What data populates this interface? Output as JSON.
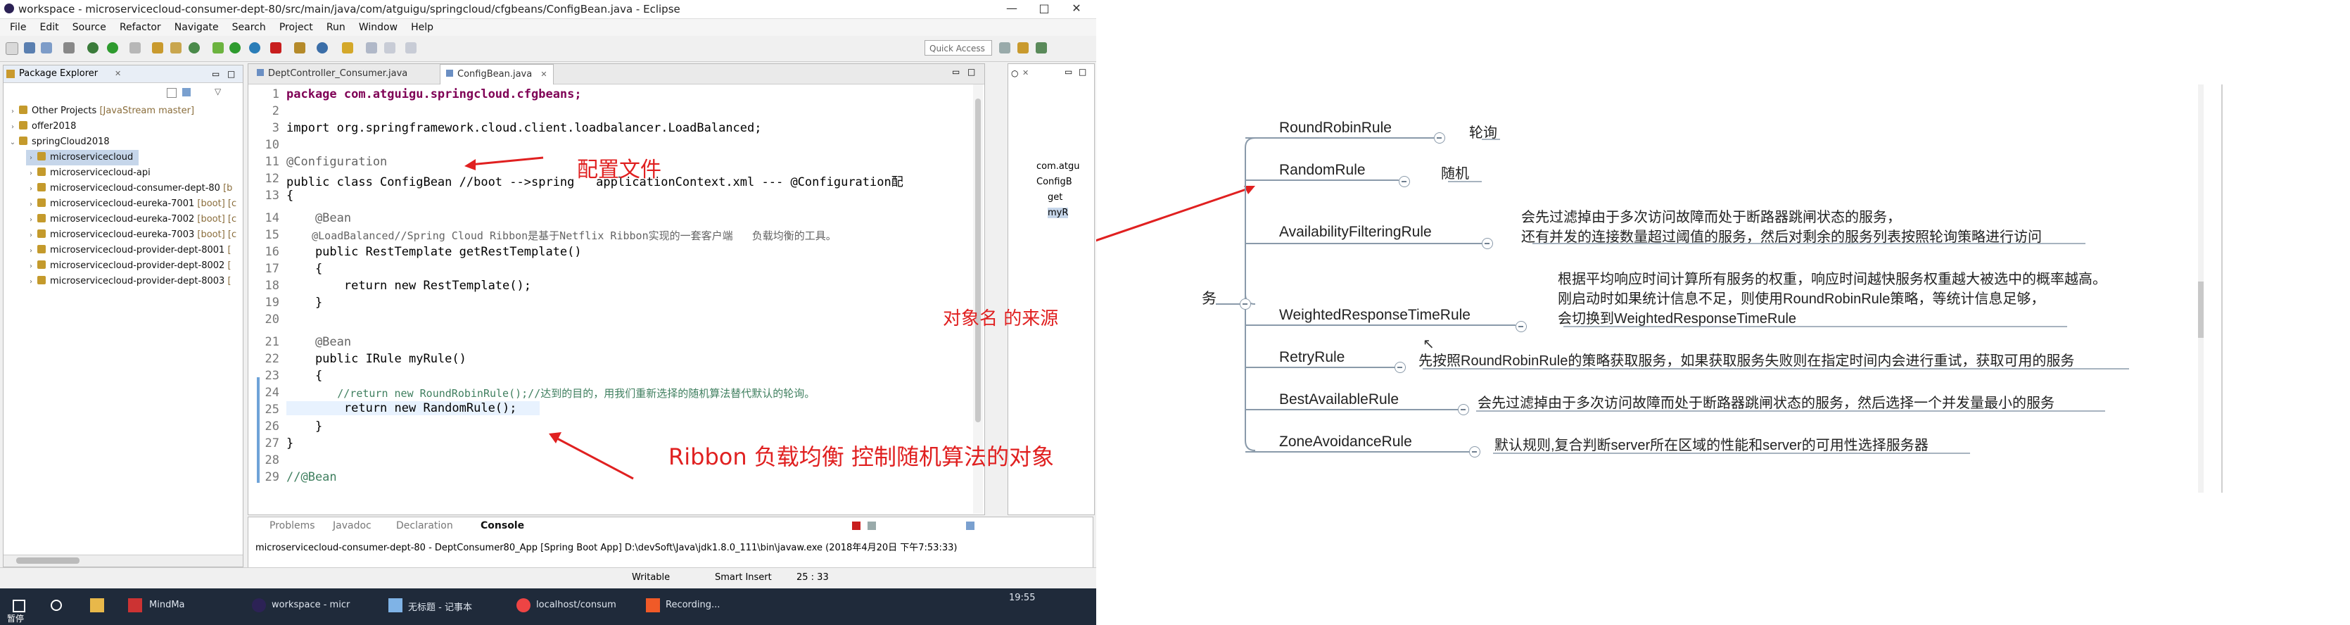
{
  "window": {
    "title": "workspace - microservicecloud-consumer-dept-80/src/main/java/com/atguigu/springcloud/cfgbeans/ConfigBean.java - Eclipse",
    "minimize": "—",
    "maximize": "□",
    "close": "✕"
  },
  "menu": [
    "File",
    "Edit",
    "Source",
    "Refactor",
    "Navigate",
    "Search",
    "Project",
    "Run",
    "Window",
    "Help"
  ],
  "toolbar": {
    "quick_access": "Quick Access"
  },
  "package_explorer": {
    "title": "Package Explorer",
    "items": [
      {
        "label": "Other Projects",
        "deco": "[JavaStream master]",
        "level": 0
      },
      {
        "label": "offer2018",
        "deco": "",
        "level": 0
      },
      {
        "label": "springCloud2018",
        "deco": "",
        "level": 0
      },
      {
        "label": "microservicecloud",
        "deco": "",
        "level": 1
      },
      {
        "label": "microservicecloud-api",
        "deco": "",
        "level": 1
      },
      {
        "label": "microservicecloud-consumer-dept-80",
        "deco": "[b",
        "level": 1
      },
      {
        "label": "microservicecloud-eureka-7001",
        "deco": "[boot] [c",
        "level": 1
      },
      {
        "label": "microservicecloud-eureka-7002",
        "deco": "[boot] [c",
        "level": 1
      },
      {
        "label": "microservicecloud-eureka-7003",
        "deco": "[boot] [c",
        "level": 1
      },
      {
        "label": "microservicecloud-provider-dept-8001",
        "deco": "[",
        "level": 1
      },
      {
        "label": "microservicecloud-provider-dept-8002",
        "deco": "[",
        "level": 1
      },
      {
        "label": "microservicecloud-provider-dept-8003",
        "deco": "[",
        "level": 1
      }
    ]
  },
  "editor": {
    "tabs": [
      "DeptController_Consumer.java",
      "ConfigBean.java"
    ],
    "lines": [
      {
        "n": "1",
        "t": "package com.atguigu.springcloud.cfgbeans;"
      },
      {
        "n": "2",
        "t": ""
      },
      {
        "n": "3",
        "t": "import org.springframework.cloud.client.loadbalancer.LoadBalanced;"
      },
      {
        "n": "10",
        "t": ""
      },
      {
        "n": "11",
        "t": "@Configuration"
      },
      {
        "n": "12",
        "t": "public class ConfigBean //boot -->spring   applicationContext.xml --- @Configuration配"
      },
      {
        "n": "13",
        "t": "{"
      },
      {
        "n": "14",
        "t": "    @Bean"
      },
      {
        "n": "15",
        "t": "    @LoadBalanced//Spring Cloud Ribbon是基于Netflix Ribbon实现的一套客户端   负载均衡的工具。"
      },
      {
        "n": "16",
        "t": "    public RestTemplate getRestTemplate()"
      },
      {
        "n": "17",
        "t": "    {"
      },
      {
        "n": "18",
        "t": "        return new RestTemplate();"
      },
      {
        "n": "19",
        "t": "    }"
      },
      {
        "n": "20",
        "t": ""
      },
      {
        "n": "21",
        "t": "    @Bean"
      },
      {
        "n": "22",
        "t": "    public IRule myRule()"
      },
      {
        "n": "23",
        "t": "    {"
      },
      {
        "n": "24",
        "t": "        //return new RoundRobinRule();//达到的目的，用我们重新选择的随机算法替代默认的轮询。"
      },
      {
        "n": "25",
        "t": "        return new RandomRule();"
      },
      {
        "n": "26",
        "t": "    }"
      },
      {
        "n": "27",
        "t": "}"
      },
      {
        "n": "28",
        "t": ""
      },
      {
        "n": "29",
        "t": "//@Bean"
      }
    ]
  },
  "overlay_notes": {
    "config_file": "配置文件",
    "object_source": "对象名 的来源",
    "ribbon_note": "Ribbon 负载均衡 控制随机算法的对象"
  },
  "console": {
    "tabs": [
      "Problems",
      "Javadoc",
      "Declaration",
      "Console"
    ],
    "text": "microservicecloud-consumer-dept-80 - DeptConsumer80_App [Spring Boot App] D:\\devSoft\\Java\\jdk1.8.0_111\\bin\\javaw.exe (2018年4月20日 下午7:53:33)"
  },
  "status": {
    "writable": "Writable",
    "insert": "Smart Insert",
    "position": "25 : 33"
  },
  "outline": {
    "items": [
      "com.atgu",
      "ConfigB",
      "get",
      "myR"
    ]
  },
  "taskbar": {
    "items": [
      "MindMa",
      "workspace - micr",
      "无标题 - 记事本",
      "localhost/consum",
      "Recording..."
    ],
    "time": "19:55",
    "corner": "暂停"
  },
  "mindmap": {
    "root_fragment": "务",
    "rules": [
      {
        "name": "RoundRobinRule",
        "desc": [
          "轮询"
        ]
      },
      {
        "name": "RandomRule",
        "desc": [
          "随机"
        ]
      },
      {
        "name": "AvailabilityFilteringRule",
        "desc": [
          "会先过滤掉由于多次访问故障而处于断路器跳闸状态的服务，",
          "还有并发的连接数量超过阈值的服务，然后对剩余的服务列表按照轮询策略进行访问"
        ]
      },
      {
        "name": "WeightedResponseTimeRule",
        "desc": [
          "根据平均响应时间计算所有服务的权重，响应时间越快服务权重越大被选中的概率越高。",
          "刚启动时如果统计信息不足，则使用RoundRobinRule策略，等统计信息足够，",
          "会切换到WeightedResponseTimeRule"
        ]
      },
      {
        "name": "RetryRule",
        "desc": [
          "先按照RoundRobinRule的策略获取服务，如果获取服务失败则在指定时间内会进行重试，获取可用的服务"
        ]
      },
      {
        "name": "BestAvailableRule",
        "desc": [
          "会先过滤掉由于多次访问故障而处于断路器跳闸状态的服务，然后选择一个并发量最小的服务"
        ]
      },
      {
        "name": "ZoneAvoidanceRule",
        "desc": [
          "默认规则,复合判断server所在区域的性能和server的可用性选择服务器"
        ]
      }
    ]
  }
}
